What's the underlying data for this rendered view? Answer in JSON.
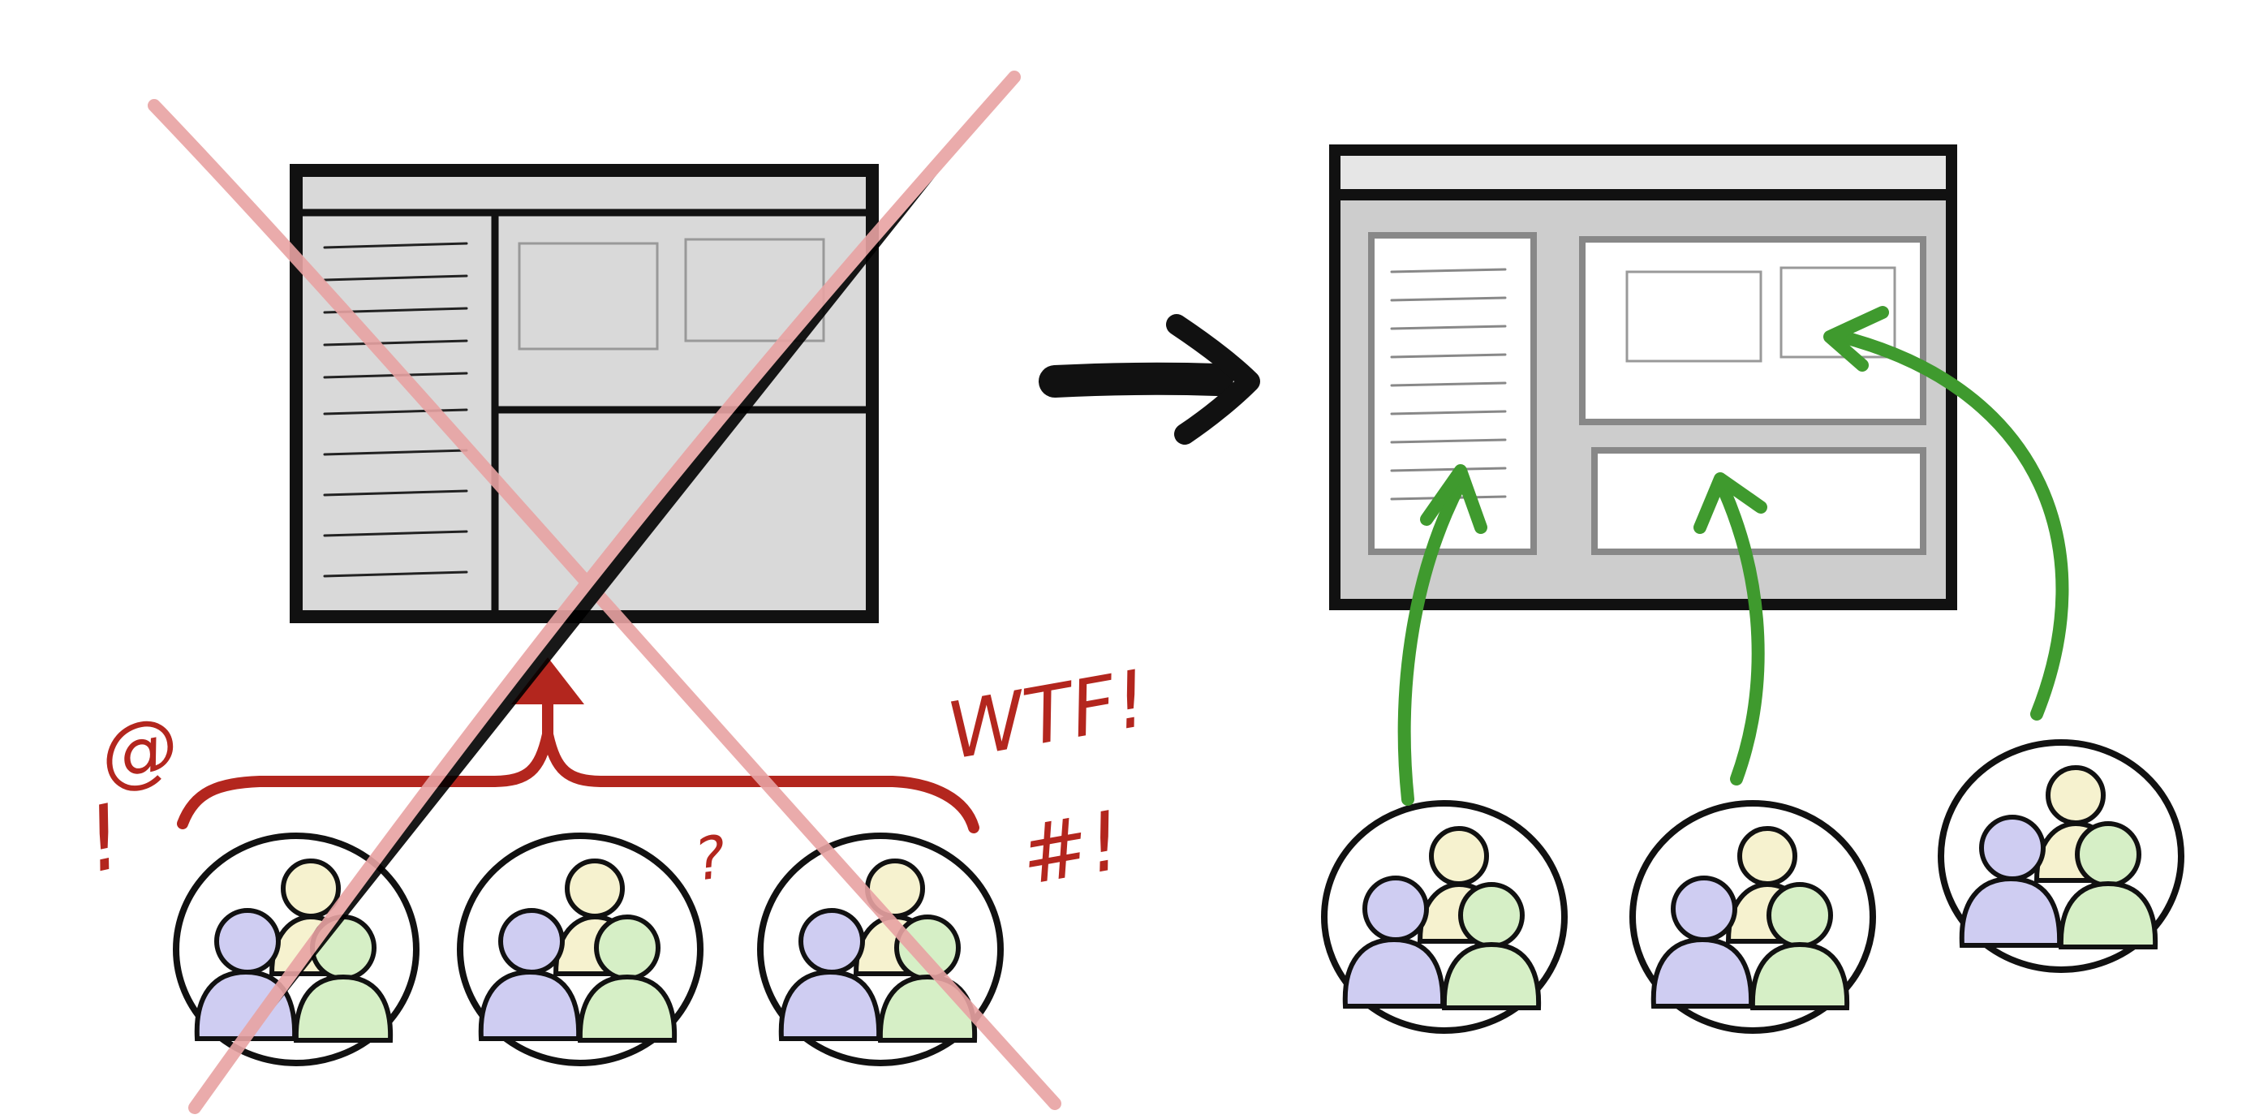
{
  "annotations": {
    "spiral": "@",
    "exclaim_left": "!",
    "wtf": "WTF!",
    "question": "?",
    "hash": "#!"
  },
  "colors": {
    "background": "#ffffff",
    "ink": "#111111",
    "window_fill": "#d9d9d9",
    "panel_fill": "#ffffff",
    "cross": "#e8a3a3",
    "bracket": "#b3261e",
    "green_arrow": "#3f9a2e",
    "person_yellow": "#f6f2cf",
    "person_blue": "#cfcdf2",
    "person_green": "#d6efc6"
  },
  "icons": {
    "left_window": "monolithic-window-icon",
    "right_window": "modular-window-icon",
    "center_arrow": "right-arrow-icon",
    "cross": "x-cross-icon",
    "groups": "people-group-icon"
  }
}
